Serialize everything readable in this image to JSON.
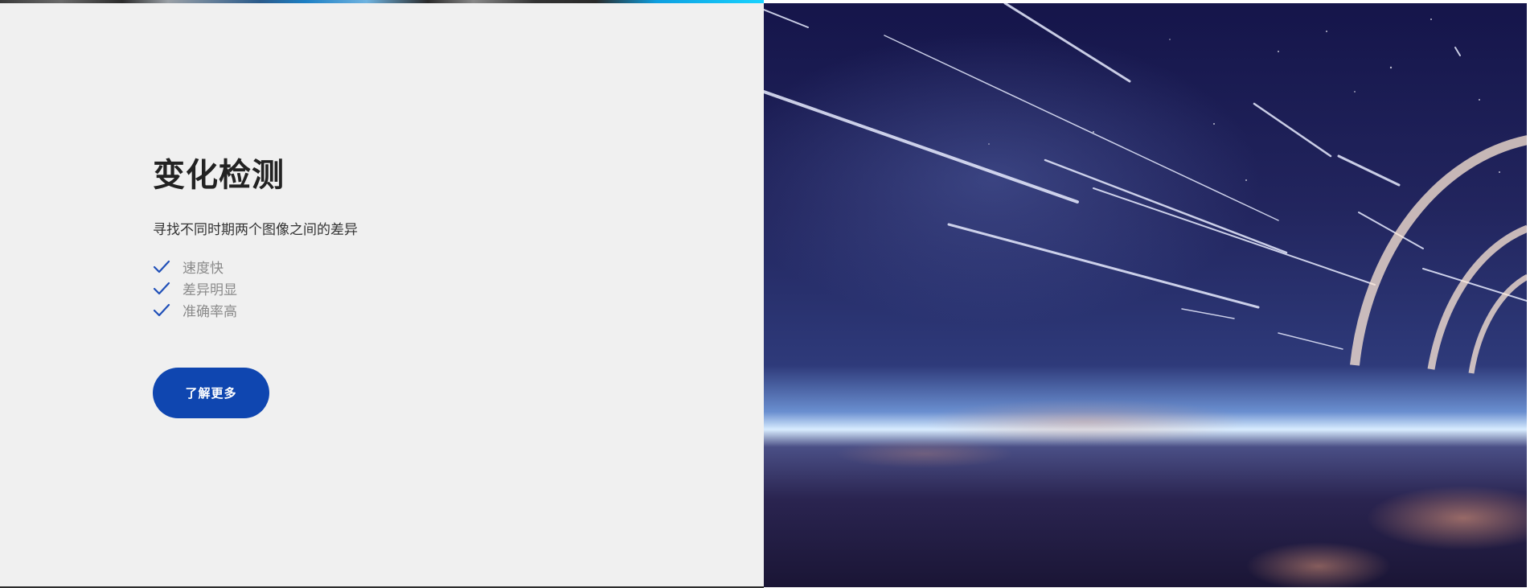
{
  "section": {
    "title": "变化检测",
    "subtitle": "寻找不同时期两个图像之间的差异",
    "features": [
      {
        "label": "速度快",
        "icon": "check-icon"
      },
      {
        "label": "差异明显",
        "icon": "check-icon"
      },
      {
        "label": "准确率高",
        "icon": "check-icon"
      }
    ],
    "cta_label": "了解更多"
  },
  "hero_image": {
    "description_icon": "space-earth-image"
  },
  "colors": {
    "panel_background": "#f0f0f0",
    "accent": "#0f46b0",
    "check": "#1f4fb8",
    "title": "#222222",
    "feature_text": "#8a8a8a"
  }
}
